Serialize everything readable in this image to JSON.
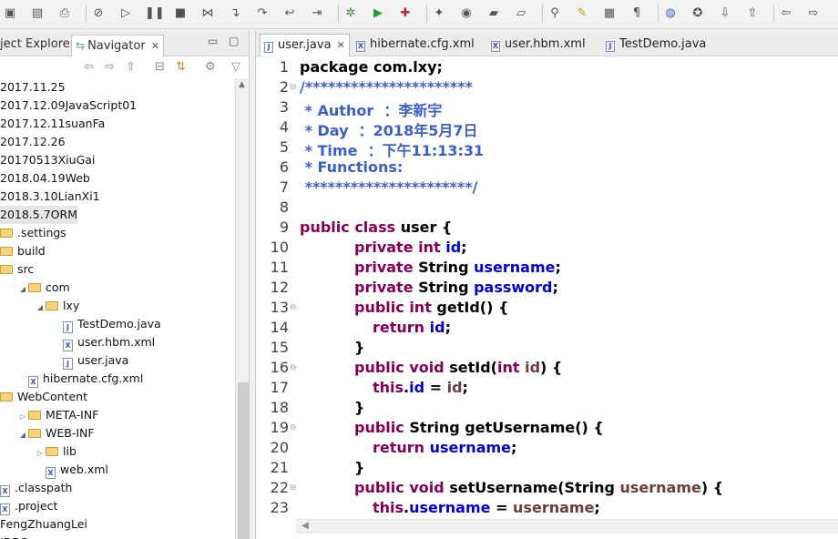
{
  "toolbar": {
    "icons": [
      "save-icon",
      "save-all-icon",
      "print-icon",
      "skip-breakpoints-icon",
      "resume-icon",
      "suspend-icon",
      "terminate-icon",
      "disconnect-icon",
      "step-into-icon",
      "step-over-icon",
      "step-return-icon",
      "use-step-filters-icon",
      "debug-icon",
      "run-icon",
      "external-tools-icon",
      "new-wizard-icon",
      "new-java-class-icon",
      "open-type-icon",
      "open-task-icon",
      "search-icon",
      "toggle-mark-occurrences-icon",
      "toggle-block-selection-icon",
      "show-whitespace-icon",
      "globe-icon",
      "toggle-ant-editor-icon",
      "next-annotation-icon",
      "previous-annotation-icon",
      "back-icon",
      "forward-icon"
    ]
  },
  "left_panel": {
    "tabs": [
      {
        "label": "ject Explorer"
      },
      {
        "label": "Navigator",
        "close": "✕"
      }
    ],
    "tree": [
      {
        "label": "2017.11.25",
        "indent": 0,
        "icon": "none",
        "twisty": ""
      },
      {
        "label": "2017.12.09JavaScript01",
        "indent": 0,
        "icon": "none",
        "twisty": ""
      },
      {
        "label": "2017.12.11suanFa",
        "indent": 0,
        "icon": "none",
        "twisty": ""
      },
      {
        "label": "2017.12.26",
        "indent": 0,
        "icon": "none",
        "twisty": ""
      },
      {
        "label": "20170513XiuGai",
        "indent": 0,
        "icon": "none",
        "twisty": ""
      },
      {
        "label": "2018.04.19Web",
        "indent": 0,
        "icon": "none",
        "twisty": ""
      },
      {
        "label": "2018.3.10LianXi1",
        "indent": 0,
        "icon": "none",
        "twisty": ""
      },
      {
        "label": "2018.5.7ORM",
        "indent": 0,
        "icon": "none",
        "twisty": "",
        "selected": true
      },
      {
        "label": ".settings",
        "indent": 0,
        "icon": "folder",
        "twisty": ""
      },
      {
        "label": "build",
        "indent": 0,
        "icon": "folder",
        "twisty": ""
      },
      {
        "label": "src",
        "indent": 0,
        "icon": "folder",
        "twisty": ""
      },
      {
        "label": "com",
        "indent": 1,
        "icon": "folder",
        "twisty": "◢"
      },
      {
        "label": "lxy",
        "indent": 2,
        "icon": "folder",
        "twisty": "◢"
      },
      {
        "label": "TestDemo.java",
        "indent": 3,
        "icon": "java",
        "twisty": ""
      },
      {
        "label": "user.hbm.xml",
        "indent": 3,
        "icon": "xml",
        "twisty": ""
      },
      {
        "label": "user.java",
        "indent": 3,
        "icon": "java",
        "twisty": ""
      },
      {
        "label": "hibernate.cfg.xml",
        "indent": 1,
        "icon": "xml",
        "twisty": ""
      },
      {
        "label": "WebContent",
        "indent": 0,
        "icon": "folder",
        "twisty": ""
      },
      {
        "label": "META-INF",
        "indent": 1,
        "icon": "folder",
        "twisty": "▷"
      },
      {
        "label": "WEB-INF",
        "indent": 1,
        "icon": "folder",
        "twisty": "◢"
      },
      {
        "label": "lib",
        "indent": 2,
        "icon": "folder",
        "twisty": "▷"
      },
      {
        "label": "web.xml",
        "indent": 2,
        "icon": "xml",
        "twisty": ""
      },
      {
        "label": ".classpath",
        "indent": 0,
        "icon": "xml",
        "twisty": ""
      },
      {
        "label": ".project",
        "indent": 0,
        "icon": "xml",
        "twisty": ""
      },
      {
        "label": "FengZhuangLei",
        "indent": 0,
        "icon": "none",
        "twisty": ""
      },
      {
        "label": "JDBC",
        "indent": 0,
        "icon": "none",
        "twisty": ""
      }
    ]
  },
  "editor": {
    "tabs": [
      {
        "label": "user.java",
        "active": true,
        "close": "✕",
        "icon": "J"
      },
      {
        "label": "hibernate.cfg.xml",
        "active": false,
        "icon": "X"
      },
      {
        "label": "user.hbm.xml",
        "active": false,
        "icon": "X"
      },
      {
        "label": "TestDemo.java",
        "active": false,
        "icon": "J"
      }
    ],
    "lines": [
      {
        "n": "1",
        "fold": "",
        "indent": 0,
        "tokens": [
          [
            "plain",
            "package com.lxy;"
          ]
        ]
      },
      {
        "n": "2",
        "fold": "⊖",
        "indent": 0,
        "tokens": [
          [
            "cmt",
            "/**********************"
          ]
        ]
      },
      {
        "n": "3",
        "fold": "",
        "indent": 0,
        "tokens": [
          [
            "cmt",
            " * Author  ：李新宇"
          ]
        ]
      },
      {
        "n": "4",
        "fold": "",
        "indent": 0,
        "tokens": [
          [
            "cmt",
            " * Day  ：2018年5月7日"
          ]
        ]
      },
      {
        "n": "5",
        "fold": "",
        "indent": 0,
        "tokens": [
          [
            "cmt",
            " * Time  ：下午11:13:31"
          ]
        ]
      },
      {
        "n": "6",
        "fold": "",
        "indent": 0,
        "tokens": [
          [
            "cmt",
            " * Functions:"
          ]
        ]
      },
      {
        "n": "7",
        "fold": "",
        "indent": 0,
        "tokens": [
          [
            "cmt",
            " **********************/"
          ]
        ]
      },
      {
        "n": "8",
        "fold": "",
        "indent": 0,
        "tokens": []
      },
      {
        "n": "9",
        "fold": "",
        "indent": 0,
        "tokens": [
          [
            "kw",
            "public class "
          ],
          [
            "plain",
            "user {"
          ]
        ]
      },
      {
        "n": "10",
        "fold": "",
        "indent": 1,
        "tokens": [
          [
            "kw",
            "private int "
          ],
          [
            "fld",
            "id"
          ],
          [
            "plain",
            ";"
          ]
        ]
      },
      {
        "n": "11",
        "fold": "",
        "indent": 1,
        "tokens": [
          [
            "kw",
            "private "
          ],
          [
            "plain",
            "String "
          ],
          [
            "fld",
            "username"
          ],
          [
            "plain",
            ";"
          ]
        ]
      },
      {
        "n": "12",
        "fold": "",
        "indent": 1,
        "tokens": [
          [
            "kw",
            "private "
          ],
          [
            "plain",
            "String "
          ],
          [
            "fld",
            "password"
          ],
          [
            "plain",
            ";"
          ]
        ]
      },
      {
        "n": "13",
        "fold": "⊖",
        "indent": 1,
        "tokens": [
          [
            "kw",
            "public int "
          ],
          [
            "plain",
            "getId() {"
          ]
        ]
      },
      {
        "n": "14",
        "fold": "",
        "indent": 2,
        "tokens": [
          [
            "kw",
            "return "
          ],
          [
            "fld",
            "id"
          ],
          [
            "plain",
            ";"
          ]
        ]
      },
      {
        "n": "15",
        "fold": "",
        "indent": 1,
        "tokens": [
          [
            "plain",
            "}"
          ]
        ]
      },
      {
        "n": "16",
        "fold": "⊖",
        "indent": 1,
        "tokens": [
          [
            "kw",
            "public void "
          ],
          [
            "plain",
            "setId("
          ],
          [
            "kw",
            "int "
          ],
          [
            "par",
            "id"
          ],
          [
            "plain",
            ") {"
          ]
        ]
      },
      {
        "n": "17",
        "fold": "",
        "indent": 2,
        "tokens": [
          [
            "kw",
            "this"
          ],
          [
            "plain",
            "."
          ],
          [
            "fld",
            "id"
          ],
          [
            "plain",
            " = "
          ],
          [
            "par",
            "id"
          ],
          [
            "plain",
            ";"
          ]
        ]
      },
      {
        "n": "18",
        "fold": "",
        "indent": 1,
        "tokens": [
          [
            "plain",
            "}"
          ]
        ]
      },
      {
        "n": "19",
        "fold": "⊖",
        "indent": 1,
        "tokens": [
          [
            "kw",
            "public "
          ],
          [
            "plain",
            "String getUsername() {"
          ]
        ]
      },
      {
        "n": "20",
        "fold": "",
        "indent": 2,
        "tokens": [
          [
            "kw",
            "return "
          ],
          [
            "fld",
            "username"
          ],
          [
            "plain",
            ";"
          ]
        ]
      },
      {
        "n": "21",
        "fold": "",
        "indent": 1,
        "tokens": [
          [
            "plain",
            "}"
          ]
        ]
      },
      {
        "n": "22",
        "fold": "⊖",
        "indent": 1,
        "tokens": [
          [
            "kw",
            "public void "
          ],
          [
            "plain",
            "setUsername(String "
          ],
          [
            "par",
            "username"
          ],
          [
            "plain",
            ") {"
          ]
        ]
      },
      {
        "n": "23",
        "fold": "",
        "indent": 2,
        "tokens": [
          [
            "kw",
            "this"
          ],
          [
            "plain",
            "."
          ],
          [
            "fld",
            "username"
          ],
          [
            "plain",
            " = "
          ],
          [
            "par",
            "username"
          ],
          [
            "plain",
            ";"
          ]
        ]
      }
    ]
  },
  "colors": {
    "comment": "#3f5fbf",
    "keyword": "#7f0055",
    "field": "#0000c0",
    "parameter": "#6a3e3e"
  }
}
